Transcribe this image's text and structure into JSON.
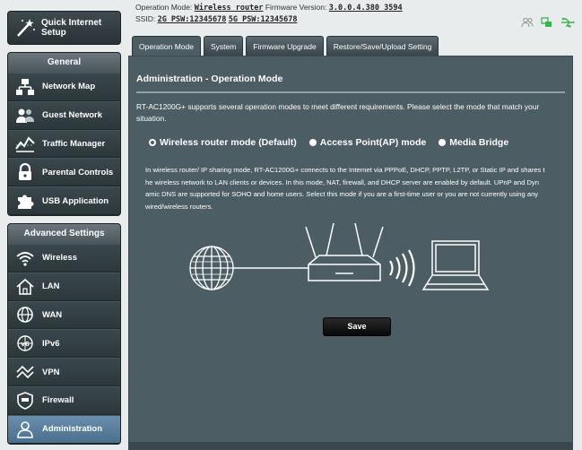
{
  "quick_setup": {
    "label": "Quick Internet Setup",
    "icon": "magic-wand-icon"
  },
  "sidebar": {
    "general_title": "General",
    "general_items": [
      {
        "label": "Network Map",
        "icon": "network-map-icon"
      },
      {
        "label": "Guest Network",
        "icon": "guest-network-icon"
      },
      {
        "label": "Traffic Manager",
        "icon": "traffic-manager-icon"
      },
      {
        "label": "Parental Controls",
        "icon": "lock-icon"
      },
      {
        "label": "USB Application",
        "icon": "puzzle-icon"
      }
    ],
    "advanced_title": "Advanced Settings",
    "advanced_items": [
      {
        "label": "Wireless",
        "icon": "wifi-icon"
      },
      {
        "label": "LAN",
        "icon": "home-icon"
      },
      {
        "label": "WAN",
        "icon": "globe-icon"
      },
      {
        "label": "IPv6",
        "icon": "ipv6-globe-icon"
      },
      {
        "label": "VPN",
        "icon": "vpn-icon"
      },
      {
        "label": "Firewall",
        "icon": "shield-icon"
      },
      {
        "label": "Administration",
        "icon": "admin-user-icon",
        "active": true
      }
    ]
  },
  "header": {
    "op_mode_label": "Operation Mode:",
    "op_mode_value": "Wireless router",
    "fw_label": "Firmware Version:",
    "fw_value": "3.0.0.4.380_3594",
    "ssid_label": "SSID:",
    "ssid_2g": "2G_PSW:12345678",
    "ssid_5g": "5G_PSW:12345678",
    "status_icons": [
      "users-icon",
      "network-status-icon",
      "usb-icon"
    ]
  },
  "tabs": [
    {
      "label": "Operation Mode",
      "active": true
    },
    {
      "label": "System"
    },
    {
      "label": "Firmware Upgrade"
    },
    {
      "label": "Restore/Save/Upload Setting"
    }
  ],
  "main": {
    "title": "Administration - Operation Mode",
    "description": "RT-AC1200G+ supports several operation modes to meet different requirements. Please select the mode that match your situation.",
    "modes": [
      {
        "label": "Wireless router mode (Default)",
        "selected": true
      },
      {
        "label": "Access Point(AP) mode",
        "selected": false
      },
      {
        "label": "Media Bridge",
        "selected": false
      }
    ],
    "mode_description_lines": [
      "In wireless router/ IP sharing mode, RT-AC1200G+ connects to the Internet via PPPoE, DHCP, PPTP, L2TP, or Static IP and shares t",
      "he wireless network to LAN clients or devices. In this mode, NAT, firewall, and DHCP server are enabled by default. UPnP and Dyn",
      "amic DNS are supported for SOHO and home users. Select this mode if you are a first-time user or you are not currently using any",
      "wired/wireless routers."
    ],
    "save_label": "Save"
  },
  "colors": {
    "panel_bg": "#4d5d64",
    "sidebar_bg": "#334045",
    "active_item": "#5a7f9c",
    "accent_green": "#3fb34f",
    "diagram_stroke": "#ffffff"
  }
}
